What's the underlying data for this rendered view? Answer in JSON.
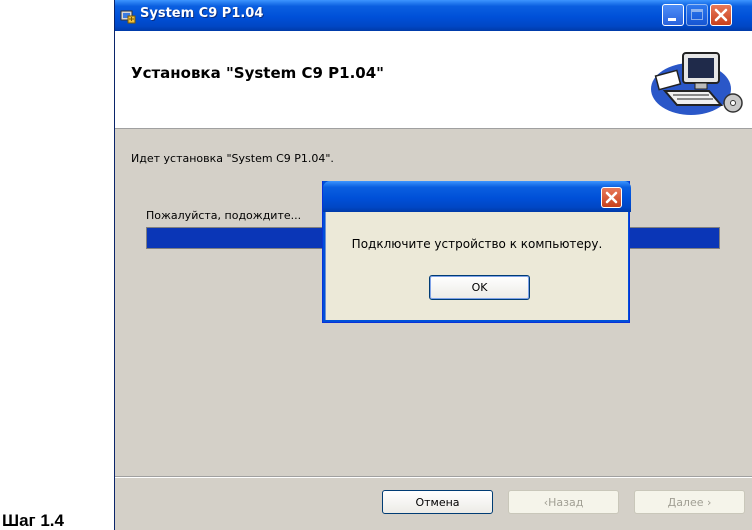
{
  "step_caption": "Шаг 1.4",
  "window": {
    "title": "System C9 P1.04",
    "icons": {
      "app": "installer-icon",
      "minimize": "minimize-icon",
      "maximize": "maximize-icon",
      "close": "close-icon",
      "banner": "computer-install-icon"
    }
  },
  "banner": {
    "title": "Установка \"System C9 P1.04\""
  },
  "status_text": "Идет установка \"System C9 P1.04\".",
  "progress": {
    "label": "Пожалуйста, подождите...",
    "value": 1.0
  },
  "buttons": {
    "cancel": "Отмена",
    "back": "‹Назад",
    "next": "Далее ›"
  },
  "dialog": {
    "message": "Подключите устройство к компьютеру.",
    "ok": "OK"
  },
  "colors": {
    "title_bar": "#0050d8",
    "progress_fill": "#0a36b7",
    "close_button": "#c8401c",
    "window_bg": "#d4d0c8",
    "dialog_bg": "#ece9d8"
  }
}
